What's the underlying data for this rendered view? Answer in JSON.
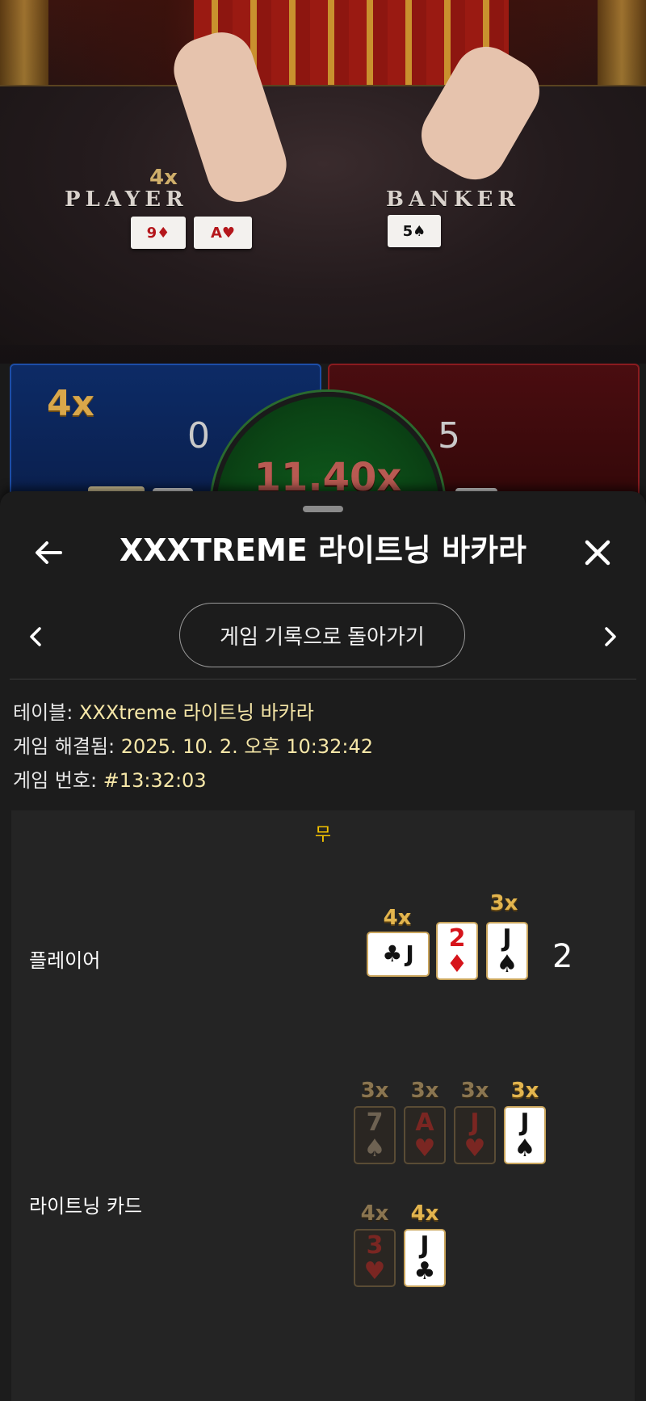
{
  "video": {
    "player_label": "PLAYER",
    "banker_label": "BANKER",
    "player_mult": "4x",
    "player_cards": [
      "9♦",
      "A♥"
    ],
    "banker_cards": [
      "5♠"
    ],
    "panel_player_mult": "4x",
    "player_score": "0",
    "banker_score": "5",
    "center_mult": "11.40x"
  },
  "sheet": {
    "title": "XXXTREME 라이트닝 바카라",
    "back_icon": "back-arrow-icon",
    "close_icon": "close-icon",
    "history_button": "게임 기록으로 돌아가기",
    "info": {
      "table_label": "테이블:",
      "table_value": "XXXtreme 라이트닝 바카라",
      "resolved_label": "게임 해결됨:",
      "resolved_value": "2025. 10. 2. 오후 10:32:42",
      "number_label": "게임 번호:",
      "number_value": "#13:32:03"
    },
    "result": {
      "outcome": "무",
      "player_label": "플레이어",
      "player_score": "2",
      "player_cards": [
        {
          "rank": "J",
          "suit": "♣",
          "color": "black",
          "mult": "4x",
          "orientation": "horizontal"
        },
        {
          "rank": "2",
          "suit": "♦",
          "color": "red",
          "mult": ""
        },
        {
          "rank": "J",
          "suit": "♠",
          "color": "black",
          "mult": "3x"
        }
      ],
      "lightning_label": "라이트닝 카드",
      "lightning_row1": [
        {
          "rank": "7",
          "suit": "♠",
          "color": "black",
          "mult": "3x",
          "dim": true
        },
        {
          "rank": "A",
          "suit": "♥",
          "color": "red",
          "mult": "3x",
          "dim": true
        },
        {
          "rank": "J",
          "suit": "♥",
          "color": "red",
          "mult": "3x",
          "dim": true
        },
        {
          "rank": "J",
          "suit": "♠",
          "color": "black",
          "mult": "3x",
          "dim": false
        }
      ],
      "lightning_row2": [
        {
          "rank": "3",
          "suit": "♥",
          "color": "red",
          "mult": "4x",
          "dim": true
        },
        {
          "rank": "J",
          "suit": "♣",
          "color": "black",
          "mult": "4x",
          "dim": false
        }
      ]
    }
  }
}
